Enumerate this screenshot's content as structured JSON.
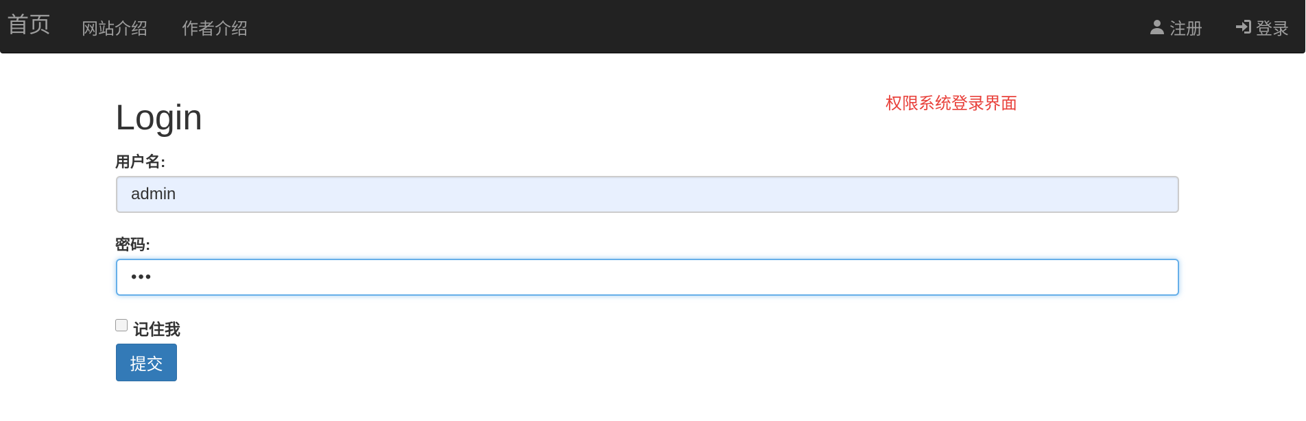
{
  "navbar": {
    "brand": "首页",
    "left_links": [
      "网站介绍",
      "作者介绍"
    ],
    "register_label": "注册",
    "login_label": "登录",
    "register_icon": "user-icon",
    "login_icon": "log-in-icon"
  },
  "main": {
    "title": "Login",
    "side_note": "权限系统登录界面",
    "username_label": "用户名:",
    "username_value": "admin",
    "password_label": "密码:",
    "password_display": "•••",
    "remember_label": "记住我",
    "remember_checked": false,
    "submit_label": "提交"
  },
  "colors": {
    "navbar_bg": "#222222",
    "nav_text": "#9d9d9d",
    "note_text": "#e8413b",
    "primary_button": "#337ab7",
    "focus_border": "#66afe9",
    "autofill_bg": "#e8f0fe"
  }
}
